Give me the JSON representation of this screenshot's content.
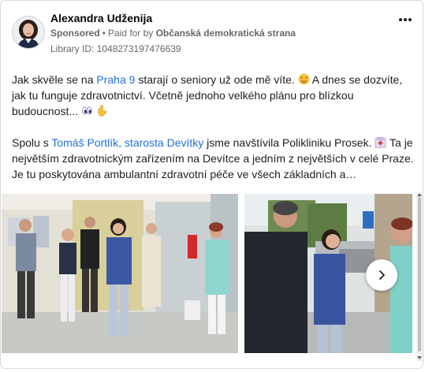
{
  "post": {
    "author_name": "Alexandra Udženija",
    "sponsored_label": "Sponsored",
    "separator": "•",
    "paid_for_prefix": "Paid for by",
    "sponsor_org": "Občanská demokratická strana",
    "library_id": "Library ID: 1048273197476639",
    "more_icon": "more-horizontal-icon",
    "paragraph1": {
      "t1": "Jak skvěle se na ",
      "link1": "Praha 9",
      "t2": " starají o seniory už ode mě víte. ",
      "t3": " A dnes se dozvíte, jak tu funguje zdravotnictví. Včetně jednoho velkého plánu pro blízkou budoucnost... "
    },
    "paragraph2": {
      "t1": "Spolu s ",
      "link1": "Tomáš Portlík, starosta Devítky",
      "t2": " jsme navštívila Polikliniku Prosek. ",
      "t3": " Ta je největším zdravotnickým zařízením na Devítce a jedním z největších v celé Praze. Je tu poskytována ambulantní zdravotní péče ve všech základních a…"
    },
    "emojis": [
      "smiling-face-icon",
      "eyes-icon",
      "pointing-down-icon",
      "hospital-icon"
    ],
    "link_color": "#216fdb"
  },
  "gallery": {
    "photos": [
      {
        "name": "group-photo-clinic-hallway"
      },
      {
        "name": "handshake-photo-clinic-entrance"
      }
    ],
    "next_icon": "chevron-right-icon"
  }
}
